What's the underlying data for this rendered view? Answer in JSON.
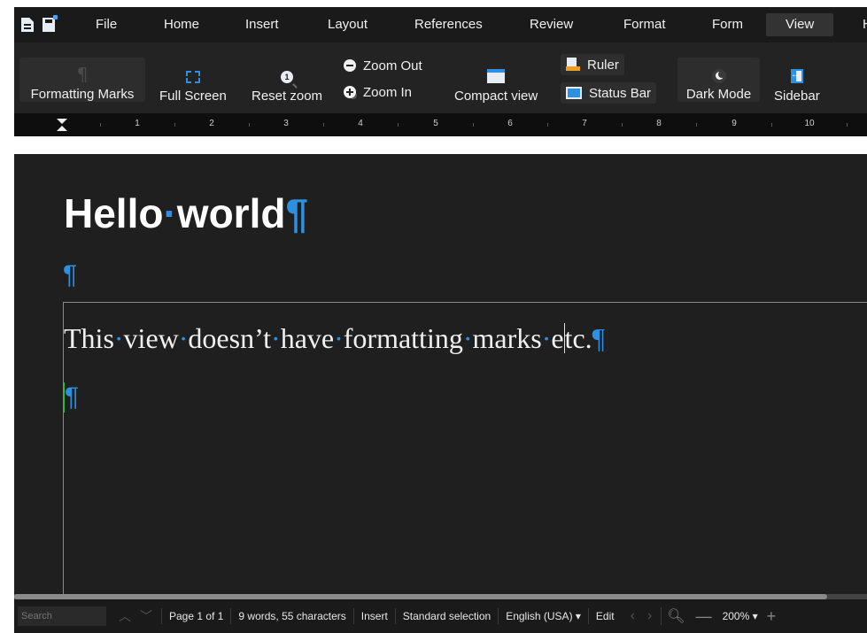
{
  "menubar": {
    "items": [
      "File",
      "Home",
      "Insert",
      "Layout",
      "References",
      "Review",
      "Format",
      "Form",
      "View",
      "H"
    ],
    "active": "View"
  },
  "ribbon": {
    "formatting_marks": "Formatting Marks",
    "full_screen": "Full Screen",
    "reset_zoom": "Reset zoom",
    "zoom_out": "Zoom Out",
    "zoom_in": "Zoom In",
    "compact_view": "Compact view",
    "ruler": "Ruler",
    "status_bar": "Status Bar",
    "dark_mode": "Dark Mode",
    "sidebar": "Sidebar"
  },
  "ruler": {
    "numbers": [
      "1",
      "2",
      "3",
      "4",
      "5",
      "6",
      "7",
      "8",
      "9",
      "10"
    ]
  },
  "document": {
    "heading": "Hello world",
    "body": "This view doesn’t have formatting marks etc.",
    "formatting_mark": "¶",
    "space_mark": "·"
  },
  "statusbar": {
    "search_placeholder": "Search",
    "page": "Page 1 of 1",
    "counts": "9 words, 55 characters",
    "mode": "Insert",
    "selection": "Standard selection",
    "language": "English (USA) ▾",
    "edit": "Edit",
    "zoom": "200% ▾"
  },
  "colors": {
    "accent": "#2f8fe0",
    "background": "#1c1c1c",
    "caret_marker": "#3bb54a"
  }
}
